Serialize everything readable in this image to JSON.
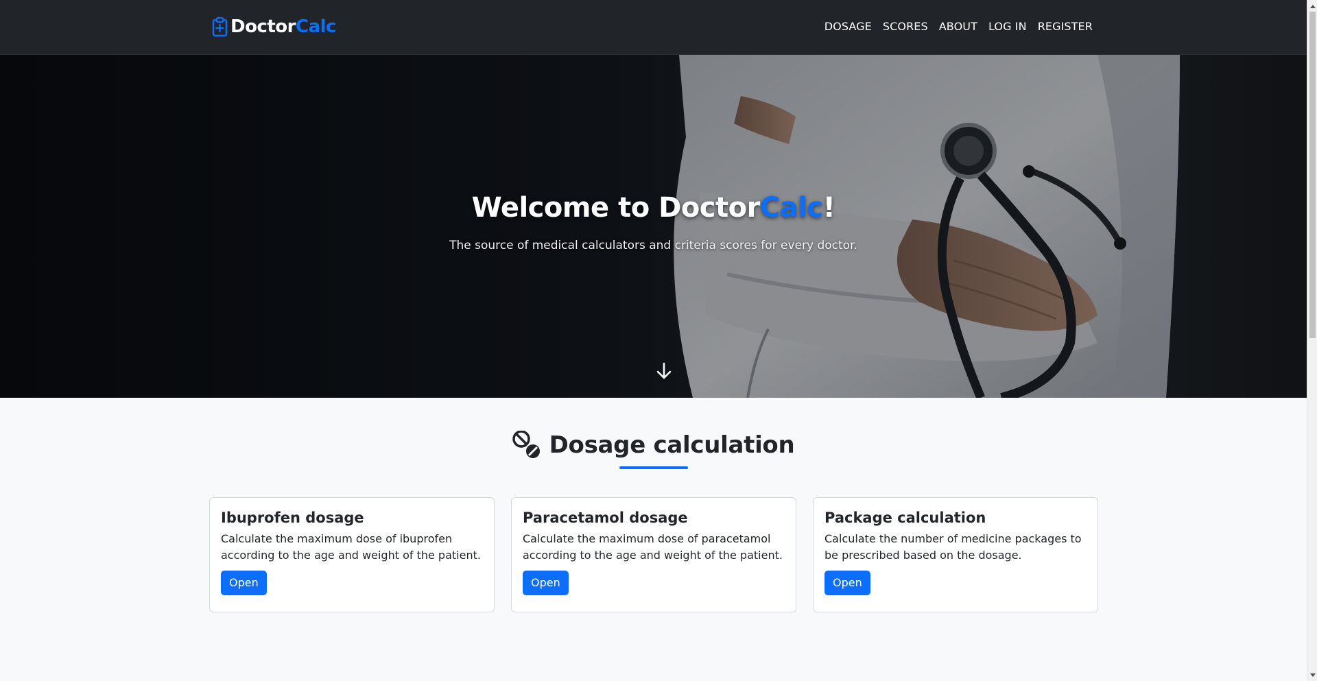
{
  "brand": {
    "name_part1": "Doctor",
    "name_part2": "Calc",
    "icon": "clipboard-plus-icon"
  },
  "nav": {
    "items": [
      {
        "label": "DOSAGE"
      },
      {
        "label": "SCORES"
      },
      {
        "label": "ABOUT"
      },
      {
        "label": "LOG IN"
      },
      {
        "label": "REGISTER"
      }
    ]
  },
  "hero": {
    "title_prefix": "Welcome to Doctor",
    "title_accent": "Calc",
    "title_suffix": "!",
    "subtitle": "The source of medical calculators and criteria scores for every doctor.",
    "scroll_icon": "arrow-down-icon"
  },
  "dosage_section": {
    "icon": "pills-icon",
    "title": "Dosage calculation",
    "cards": [
      {
        "title": "Ibuprofen dosage",
        "text": "Calculate the maximum dose of ibuprofen according to the age and weight of the patient.",
        "button": "Open"
      },
      {
        "title": "Paracetamol dosage",
        "text": "Calculate the maximum dose of paracetamol according to the age and weight of the patient.",
        "button": "Open"
      },
      {
        "title": "Package calculation",
        "text": "Calculate the number of medicine packages to be prescribed based on the dosage.",
        "button": "Open"
      }
    ]
  },
  "colors": {
    "navbar_bg": "#212529",
    "accent": "#0d6efd",
    "page_bg": "#f8f9fa"
  }
}
